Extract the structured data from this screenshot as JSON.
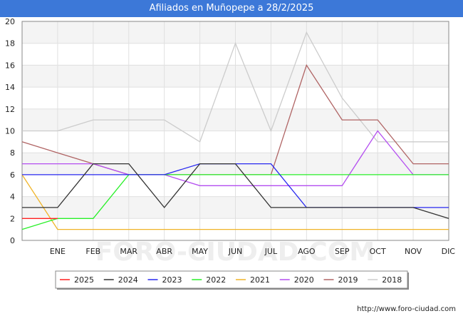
{
  "header": {
    "title": "Afiliados en Muñopepe a 28/2/2025"
  },
  "footer": {
    "url": "http://www.foro-ciudad.com"
  },
  "watermark": "FORO-CIUDAD.COM",
  "chart_data": {
    "type": "line",
    "title": "Afiliados en Muñopepe a 28/2/2025",
    "xlabel": "",
    "ylabel": "",
    "ylim": [
      0,
      20
    ],
    "yticks": [
      0,
      2,
      4,
      6,
      8,
      10,
      12,
      14,
      16,
      18,
      20
    ],
    "categories": [
      "",
      "ENE",
      "FEB",
      "MAR",
      "ABR",
      "MAY",
      "JUN",
      "JUL",
      "AGO",
      "SEP",
      "OCT",
      "NOV",
      "DIC"
    ],
    "grid": true,
    "legend": "bottom",
    "series": [
      {
        "name": "2018",
        "color": "#cccccc",
        "values": [
          10,
          10,
          11,
          11,
          11,
          9,
          18,
          10,
          19,
          13,
          9,
          9,
          9
        ]
      },
      {
        "name": "2019",
        "color": "#b06464",
        "values": [
          9,
          8,
          7,
          6,
          6,
          6,
          6,
          6,
          16,
          11,
          11,
          7,
          7
        ]
      },
      {
        "name": "2020",
        "color": "#b44ef0",
        "values": [
          7,
          7,
          7,
          6,
          6,
          5,
          5,
          5,
          5,
          5,
          10,
          6,
          6
        ]
      },
      {
        "name": "2021",
        "color": "#f0b428",
        "values": [
          6,
          1,
          1,
          1,
          1,
          1,
          1,
          1,
          1,
          1,
          1,
          1,
          1
        ]
      },
      {
        "name": "2022",
        "color": "#28f028",
        "values": [
          1,
          2,
          2,
          6,
          6,
          6,
          6,
          6,
          6,
          6,
          6,
          6,
          6
        ]
      },
      {
        "name": "2023",
        "color": "#2828f0",
        "values": [
          6,
          6,
          6,
          6,
          6,
          7,
          7,
          7,
          3,
          3,
          3,
          3,
          3
        ]
      },
      {
        "name": "2024",
        "color": "#323232",
        "values": [
          3,
          3,
          7,
          7,
          3,
          7,
          7,
          3,
          3,
          3,
          3,
          3,
          2
        ]
      },
      {
        "name": "2025",
        "color": "#ff2020",
        "values": [
          2,
          2,
          null,
          null,
          null,
          null,
          null,
          null,
          null,
          null,
          null,
          null,
          null
        ]
      }
    ],
    "legend_order": [
      "2025",
      "2024",
      "2023",
      "2022",
      "2021",
      "2020",
      "2019",
      "2018"
    ]
  }
}
